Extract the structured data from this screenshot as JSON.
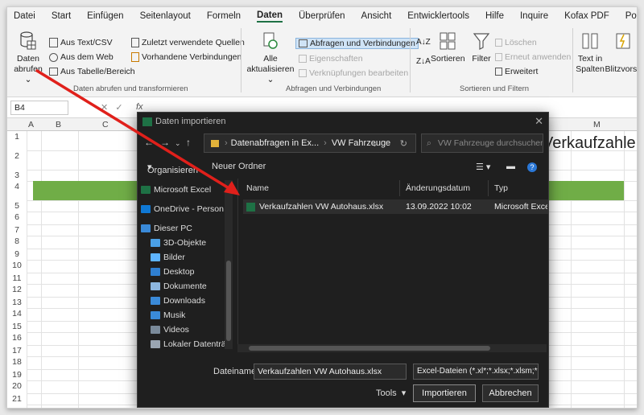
{
  "menu": {
    "tabs": [
      "Datei",
      "Start",
      "Einfügen",
      "Seitenlayout",
      "Formeln",
      "Daten",
      "Überprüfen",
      "Ansicht",
      "Entwicklertools",
      "Hilfe",
      "Inquire",
      "Kofax PDF",
      "Power Pivot"
    ],
    "active_index": 5
  },
  "ribbon": {
    "daten_abrufen": "Daten",
    "daten_abrufen_2": "abrufen",
    "aus_text_csv": "Aus Text/CSV",
    "aus_dem_web": "Aus dem Web",
    "aus_tabelle": "Aus Tabelle/Bereich",
    "zuletzt": "Zuletzt verwendete Quellen",
    "vorhandene": "Vorhandene Verbindungen",
    "group1": "Daten abrufen und transformieren",
    "alle": "Alle",
    "aktualisieren": "aktualisieren",
    "abfragen": "Abfragen und Verbindungen",
    "eigenschaften": "Eigenschaften",
    "verknuepfungen": "Verknüpfungen bearbeiten",
    "group2": "Abfragen und Verbindungen",
    "sortieren": "Sortieren",
    "filter": "Filter",
    "loeschen": "Löschen",
    "erneut": "Erneut anwenden",
    "erweitert": "Erweitert",
    "group3": "Sortieren und Filtern",
    "text_in": "Text in",
    "spalten": "Spalten",
    "blitzvorschau": "Blitzvorsc"
  },
  "formula_bar": {
    "name_box": "B4",
    "fx": "fx"
  },
  "sheet": {
    "columns": [
      "A",
      "B",
      "C",
      "M"
    ],
    "rows": [
      "1",
      "2",
      "3",
      "4",
      "5",
      "6",
      "7",
      "8",
      "9",
      "10",
      "11",
      "12",
      "13",
      "14",
      "15",
      "16",
      "17",
      "18",
      "19",
      "20",
      "21"
    ],
    "title_text": "Verkaufzahlen"
  },
  "dialog": {
    "title": "Daten importieren",
    "address_parts": [
      "Datenabfragen in Ex...",
      "VW Fahrzeuge"
    ],
    "search_placeholder": "VW Fahrzeuge durchsuchen",
    "organize": "Organisieren",
    "new_folder": "Neuer Ordner",
    "nav_items": [
      {
        "label": "Microsoft Excel",
        "color": "#1e7145"
      },
      {
        "label": "OneDrive - Person",
        "color": "#0f78d4"
      },
      {
        "label": "Dieser PC",
        "color": "#3a8ad8"
      },
      {
        "label": "3D-Objekte",
        "color": "#4aa0e6"
      },
      {
        "label": "Bilder",
        "color": "#5eb4ff"
      },
      {
        "label": "Desktop",
        "color": "#2f7fd0"
      },
      {
        "label": "Dokumente",
        "color": "#8db7e0"
      },
      {
        "label": "Downloads",
        "color": "#3a8ad8"
      },
      {
        "label": "Musik",
        "color": "#3a8ad8"
      },
      {
        "label": "Videos",
        "color": "#7a8a9a"
      },
      {
        "label": "Lokaler Datenträ",
        "color": "#9aa5b1"
      }
    ],
    "columns": [
      "Name",
      "Änderungsdatum",
      "Typ"
    ],
    "files": [
      {
        "name": "Verkaufzahlen VW Autohaus.xlsx",
        "date": "13.09.2022 10:02",
        "type": "Microsoft Excel-A"
      }
    ],
    "filename_label": "Dateiname:",
    "filename_value": "Verkaufzahlen VW Autohaus.xlsx",
    "filetype_value": "Excel-Dateien (*.xl*;*.xlsx;*.xlsm;*.x",
    "tools": "Tools",
    "import_button": "Importieren",
    "cancel_button": "Abbrechen"
  },
  "colors": {
    "excel_green": "#1e7145",
    "header_green": "#70ad47",
    "arrow_red": "#e0201b"
  }
}
